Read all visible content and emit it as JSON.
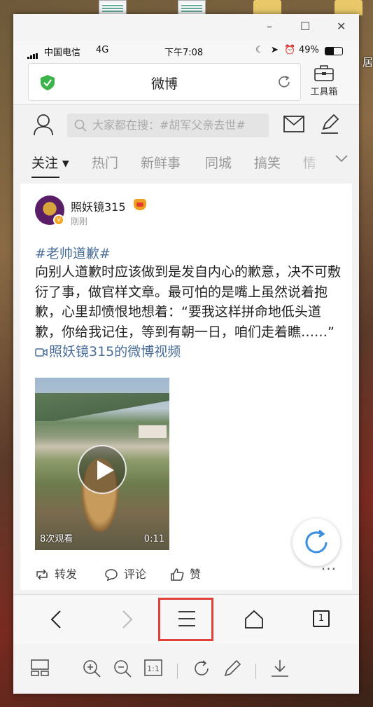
{
  "window": {
    "controls": {
      "minimize": "–",
      "maximize": "☐",
      "close": "✕"
    }
  },
  "status": {
    "carrier": "中国电信",
    "network": "4G",
    "time": "下午7:08",
    "battery": "49%",
    "battery_level": 0.49
  },
  "browser": {
    "page_title": "微博",
    "toolbox_label": "工具箱"
  },
  "weibo": {
    "search_placeholder": "大家都在搜：#胡军父亲去世#",
    "tabs": [
      {
        "label": "关注 ▾"
      },
      {
        "label": "热门"
      },
      {
        "label": "新鲜事"
      },
      {
        "label": "同城"
      },
      {
        "label": "搞笑"
      },
      {
        "label": "情"
      }
    ]
  },
  "post": {
    "username": "照妖镜315",
    "verified_mark": "v",
    "time": "刚刚",
    "topic": "#老帅道歉#",
    "text": "向别人道歉时应该做到是发自内心的歉意，决不可敷衍了事，做官样文章。最可怕的是嘴上虽然说着抱歉，心里却愤恨地想着：“要我这样拼命地低头道歉，你给我记住，等到有朝一日，咱们走着瞧……”",
    "video_link": "照妖镜315的微博视频",
    "video": {
      "views": "8次观看",
      "duration": "0:11"
    },
    "actions": {
      "repost": "转发",
      "comment": "评论",
      "like": "赞",
      "more": "···"
    }
  },
  "navbar": {
    "tab_count": "1"
  },
  "icons": {
    "toolbar": [
      "layout-icon",
      "zoom-in-icon",
      "zoom-out-icon",
      "actual-size-icon",
      "rotate-icon",
      "pen-icon",
      "download-icon"
    ],
    "actual_size_label": "1:1"
  },
  "desktop": {
    "label_fragment": "居"
  },
  "colors": {
    "link": "#4a6e9a",
    "highlight": "#e0403a",
    "fab_accent": "#3b8fe0"
  }
}
